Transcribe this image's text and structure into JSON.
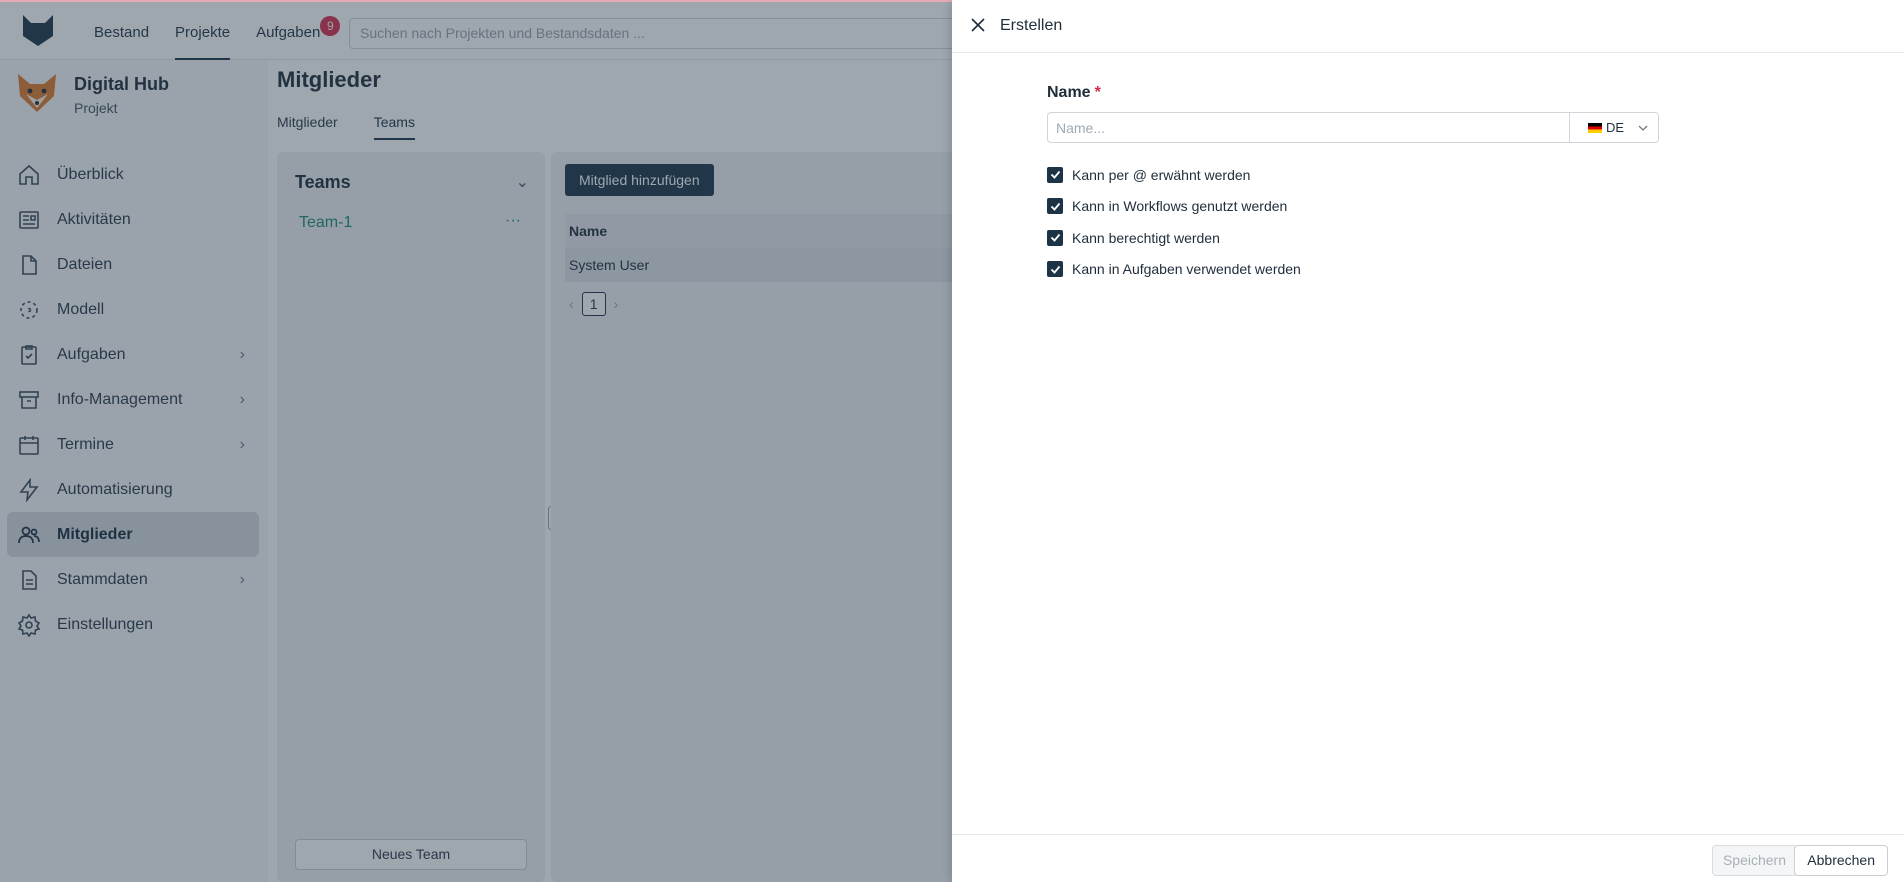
{
  "topbar": {
    "nav": [
      {
        "label": "Bestand"
      },
      {
        "label": "Projekte"
      },
      {
        "label": "Aufgaben",
        "badge": "9"
      }
    ],
    "search_placeholder": "Suchen nach Projekten und Bestandsdaten ..."
  },
  "project": {
    "title": "Digital Hub",
    "subtitle": "Projekt"
  },
  "sidebar": {
    "items": [
      {
        "label": "Überblick",
        "icon": "home-icon"
      },
      {
        "label": "Aktivitäten",
        "icon": "newspaper-icon"
      },
      {
        "label": "Dateien",
        "icon": "file-icon"
      },
      {
        "label": "Modell",
        "icon": "model-icon"
      },
      {
        "label": "Aufgaben",
        "icon": "clipboard-check-icon",
        "has_children": true
      },
      {
        "label": "Info-Management",
        "icon": "archive-icon",
        "has_children": true
      },
      {
        "label": "Termine",
        "icon": "calendar-icon",
        "has_children": true
      },
      {
        "label": "Automatisierung",
        "icon": "lightning-icon"
      },
      {
        "label": "Mitglieder",
        "icon": "users-icon",
        "active": true
      },
      {
        "label": "Stammdaten",
        "icon": "document-list-icon",
        "has_children": true
      },
      {
        "label": "Einstellungen",
        "icon": "gear-icon"
      }
    ]
  },
  "main": {
    "title": "Mitglieder",
    "tabs": [
      {
        "label": "Mitglieder"
      },
      {
        "label": "Teams",
        "active": true
      }
    ],
    "teams_panel": {
      "title": "Teams",
      "items": [
        {
          "label": "Team-1",
          "more": "···"
        }
      ],
      "new_team": "Neues Team"
    },
    "members_panel": {
      "add_button": "Mitglied hinzufügen",
      "columns": [
        "Name"
      ],
      "rows": [
        {
          "name": "System User"
        }
      ],
      "page": "1"
    }
  },
  "drawer": {
    "title": "Erstellen",
    "name_label": "Name",
    "required_mark": "*",
    "name_placeholder": "Name...",
    "language": "DE",
    "checkboxes": [
      {
        "label": "Kann per @ erwähnt werden",
        "checked": true
      },
      {
        "label": "Kann in Workflows genutzt werden",
        "checked": true
      },
      {
        "label": "Kann berechtigt werden",
        "checked": true
      },
      {
        "label": "Kann in Aufgaben verwendet werden",
        "checked": true
      }
    ],
    "save_label": "Speichern",
    "cancel_label": "Abbrechen"
  },
  "colors": {
    "accent": "#1d3447",
    "badge": "#d72c4c",
    "team_link": "#1f8a7a",
    "overlay": "#283a4b"
  }
}
